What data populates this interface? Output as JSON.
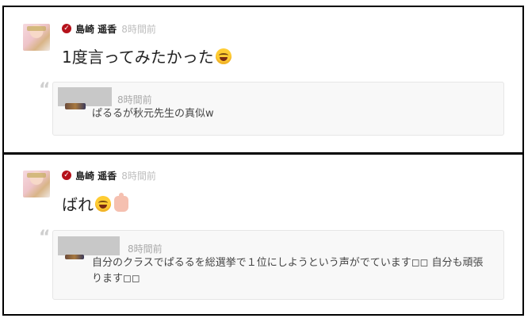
{
  "posts": [
    {
      "author": "島崎 遥香",
      "time": "8時間前",
      "message": "1度言ってみたかった",
      "emojis": [
        "laugh-emoji"
      ],
      "reply": {
        "time": "8時間前",
        "text": "ぱるるが秋元先生の真似w"
      }
    },
    {
      "author": "島崎 遥香",
      "time": "8時間前",
      "message": "ばれ",
      "emojis": [
        "laugh-emoji",
        "thumbs-up-emoji"
      ],
      "reply": {
        "time": "8時間前",
        "text": "自分のクラスでぱるるを総選挙で１位にしようという声がでています◻︎◻︎ 自分も頑張ります◻︎◻︎"
      }
    }
  ],
  "icons": {
    "verified": "verified-check-icon",
    "quote": "quote-icon"
  },
  "colors": {
    "verified": "#b5121b",
    "time": "#bdbdbd",
    "card_bg": "#f8f8f8",
    "quote": "#cfcfcf"
  }
}
